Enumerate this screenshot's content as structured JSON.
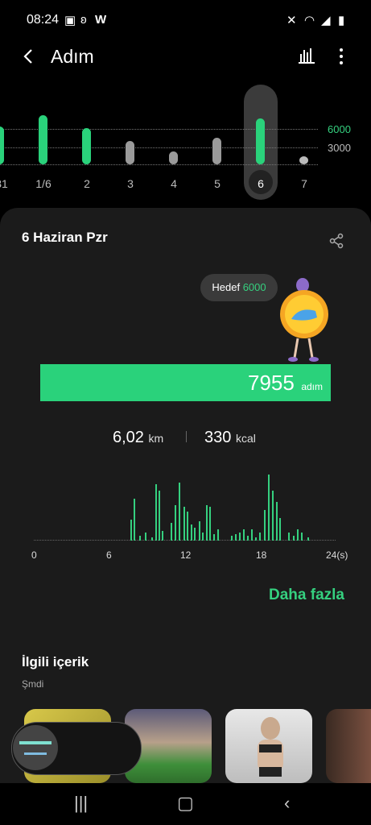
{
  "status": {
    "time": "08:24",
    "left_icons": [
      "image-icon",
      "bluetooth-icon",
      "wave-icon"
    ],
    "right_icons": [
      "mute-icon",
      "wifi-icon",
      "signal-icon",
      "battery-icon"
    ]
  },
  "header": {
    "title": "Adım",
    "back_icon": "back-arrow-icon",
    "chart_icon": "bar-chart-icon",
    "more_icon": "more-vertical-icon"
  },
  "week": {
    "goal_labels": [
      "6000",
      "3000"
    ],
    "days": [
      {
        "label": "31",
        "steps": 6500,
        "goal_met": true
      },
      {
        "label": "1/6",
        "steps": 8500,
        "goal_met": true
      },
      {
        "label": "2",
        "steps": 6300,
        "goal_met": true
      },
      {
        "label": "3",
        "steps": 4000,
        "goal_met": false
      },
      {
        "label": "4",
        "steps": 2200,
        "goal_met": false
      },
      {
        "label": "5",
        "steps": 4600,
        "goal_met": false
      },
      {
        "label": "6",
        "steps": 7955,
        "goal_met": true,
        "selected": true
      },
      {
        "label": "7",
        "steps": 500,
        "goal_met": false
      }
    ]
  },
  "card": {
    "date": "6 Haziran Pzr",
    "goal_prefix": "Hedef",
    "goal_value": "6000",
    "steps": "7955",
    "steps_unit": "adım",
    "progress": 1.0,
    "distance": "6,02",
    "distance_unit": "km",
    "calories": "330",
    "calories_unit": "kcal",
    "hourly_axis": [
      "0",
      "6",
      "12",
      "18",
      "24(s)"
    ],
    "more_label": "Daha fazla",
    "colors": {
      "accent": "#2ad27b",
      "card": "#1b1b1b"
    }
  },
  "related": {
    "title": "İlgili içerik",
    "subtitle": "Şmdi"
  },
  "nav": {
    "recents_icon": "recents-icon",
    "home_icon": "home-icon",
    "back_icon": "nav-back-icon"
  }
}
